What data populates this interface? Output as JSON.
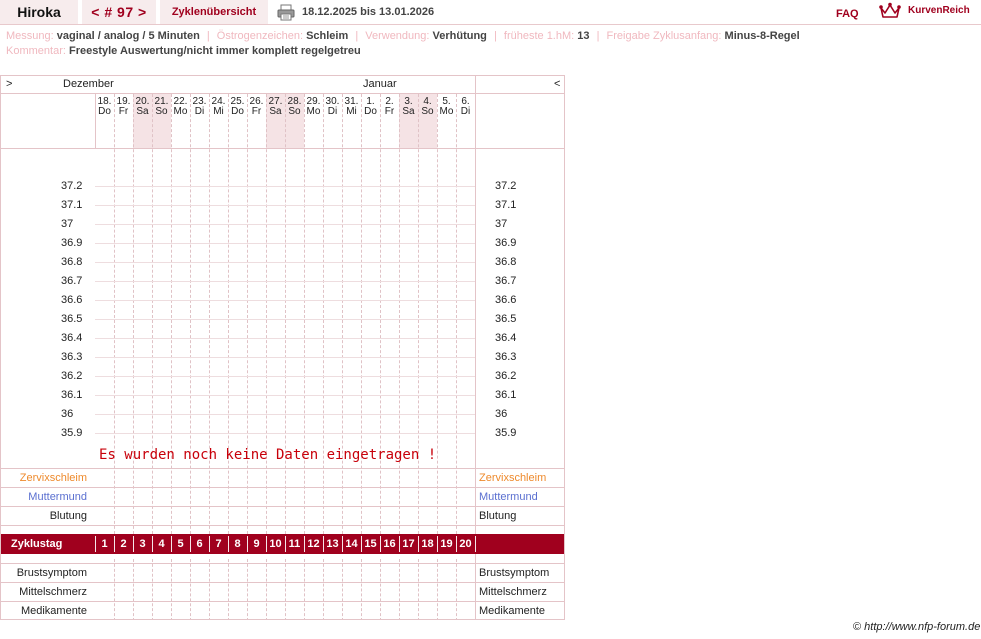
{
  "header": {
    "user": "Hiroka",
    "cycle_number": "< # 97 >",
    "overview_link": "Zyklenübersicht",
    "date_range": "18.12.2025 bis 13.01.2026",
    "faq": "FAQ",
    "brand": "KurvenReich"
  },
  "info": {
    "messung_label": "Messung:",
    "messung_value": "vaginal / analog / 5 Minuten",
    "oestrogen_label": "Östrogenzeichen:",
    "oestrogen_value": "Schleim",
    "verwendung_label": "Verwendung:",
    "verwendung_value": "Verhütung",
    "hm_label": "früheste 1.hM:",
    "hm_value": "13",
    "freigabe_label": "Freigabe Zyklusanfang:",
    "freigabe_value": "Minus-8-Regel",
    "kommentar_label": "Kommentar:",
    "kommentar_value": "Freestyle Auswertung/nicht immer komplett regelgetreu"
  },
  "chart": {
    "nav_prev": ">",
    "nav_next": "<",
    "month_1": "Dezember",
    "month_2": "Januar",
    "days": [
      {
        "num": "18.",
        "dow": "Do",
        "weekend": false
      },
      {
        "num": "19.",
        "dow": "Fr",
        "weekend": false
      },
      {
        "num": "20.",
        "dow": "Sa",
        "weekend": true
      },
      {
        "num": "21.",
        "dow": "So",
        "weekend": true
      },
      {
        "num": "22.",
        "dow": "Mo",
        "weekend": false
      },
      {
        "num": "23.",
        "dow": "Di",
        "weekend": false
      },
      {
        "num": "24.",
        "dow": "Mi",
        "weekend": false
      },
      {
        "num": "25.",
        "dow": "Do",
        "weekend": false
      },
      {
        "num": "26.",
        "dow": "Fr",
        "weekend": false
      },
      {
        "num": "27.",
        "dow": "Sa",
        "weekend": true
      },
      {
        "num": "28.",
        "dow": "So",
        "weekend": true
      },
      {
        "num": "29.",
        "dow": "Mo",
        "weekend": false
      },
      {
        "num": "30.",
        "dow": "Di",
        "weekend": false
      },
      {
        "num": "31.",
        "dow": "Mi",
        "weekend": false
      },
      {
        "num": "1.",
        "dow": "Do",
        "weekend": false
      },
      {
        "num": "2.",
        "dow": "Fr",
        "weekend": false
      },
      {
        "num": "3.",
        "dow": "Sa",
        "weekend": true
      },
      {
        "num": "4.",
        "dow": "So",
        "weekend": true
      },
      {
        "num": "5.",
        "dow": "Mo",
        "weekend": false
      },
      {
        "num": "6.",
        "dow": "Di",
        "weekend": false
      }
    ],
    "temperatures": [
      "37.2",
      "37.1",
      "37",
      "36.9",
      "36.8",
      "36.7",
      "36.6",
      "36.5",
      "36.4",
      "36.3",
      "36.2",
      "36.1",
      "36",
      "35.9"
    ],
    "no_data_message": "Es wurden noch keine Daten eingetragen !",
    "rows_top": [
      "Zervixschleim",
      "Muttermund",
      "Blutung"
    ],
    "cycle_day_label": "Zyklustag",
    "cycle_days": [
      "1",
      "2",
      "3",
      "4",
      "5",
      "6",
      "7",
      "8",
      "9",
      "10",
      "11",
      "12",
      "13",
      "14",
      "15",
      "16",
      "17",
      "18",
      "19",
      "20"
    ],
    "rows_bottom": [
      "Brustsymptom",
      "Mittelschmerz",
      "Medikamente"
    ]
  },
  "footer": {
    "copyright_symbol": "©",
    "copyright_url": "http://www.nfp-forum.de"
  },
  "colors": {
    "accent": "#a0001e",
    "zervixschleim": "#ee8a2c",
    "muttermund": "#5a6fd0",
    "label_pink": "#f0b8bf"
  }
}
